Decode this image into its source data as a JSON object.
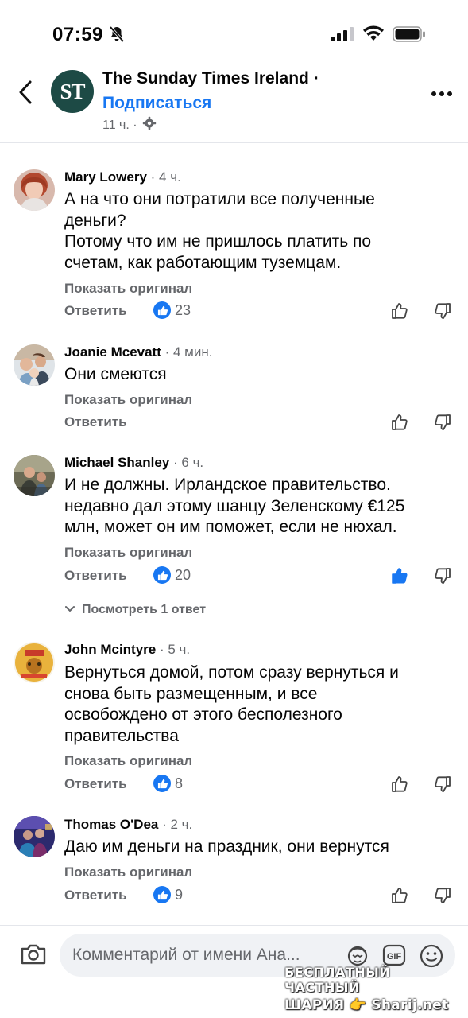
{
  "status_bar": {
    "time": "07:59"
  },
  "header": {
    "logo_text": "ST",
    "page_name": "The Sunday Times Ireland ·",
    "subscribe_label": "Подписаться",
    "post_age": "11 ч. ·"
  },
  "comments": [
    {
      "name": "Mary Lowery",
      "time": " · 4 ч.",
      "text": [
        "А на что они потратили все полученные",
        "деньги?",
        "Потому что им не пришлось платить по",
        "счетам, как работающим туземцам."
      ],
      "show_original": "Показать оригинал",
      "reply_label": "Ответить",
      "likes": "23"
    },
    {
      "name": "Joanie Mcevatt",
      "time": " · 4 мин.",
      "text": [
        "Они смеются"
      ],
      "show_original": "Показать оригинал",
      "reply_label": "Ответить",
      "likes": ""
    },
    {
      "name": "Michael Shanley",
      "time": " · 6 ч.",
      "text": [
        "И не должны. Ирландское правительство.",
        "недавно дал этому шанцу Зеленскому €125",
        "млн, может он им поможет, если не нюхал."
      ],
      "show_original": "Показать оригинал",
      "reply_label": "Ответить",
      "likes": "20",
      "view_replies": "Посмотреть 1 ответ"
    },
    {
      "name": "John Mcintyre",
      "time": " · 5 ч.",
      "text": [
        "Вернуться домой, потом сразу вернуться и",
        "снова быть размещенным, и все",
        "освобождено от этого бесполезного",
        "правительства"
      ],
      "show_original": "Показать оригинал",
      "reply_label": "Ответить",
      "likes": "8"
    },
    {
      "name": "Thomas O'Dea",
      "time": " · 2 ч.",
      "text": [
        "Даю им деньги на праздник, они вернутся"
      ],
      "show_original": "Показать оригинал",
      "reply_label": "Ответить",
      "likes": "9"
    }
  ],
  "composer": {
    "placeholder": "Комментарий от имени Ана...",
    "gif_label": "GIF"
  },
  "watermark": {
    "line1": "БЕСПЛАТНЫЙ ЧАСТНЫЙ",
    "line2": "ШАРИЯ 👉 Sharij.net"
  },
  "colors": {
    "accent": "#1877f2",
    "secondary_text": "#65676b",
    "logo_bg": "#1d4a45"
  }
}
